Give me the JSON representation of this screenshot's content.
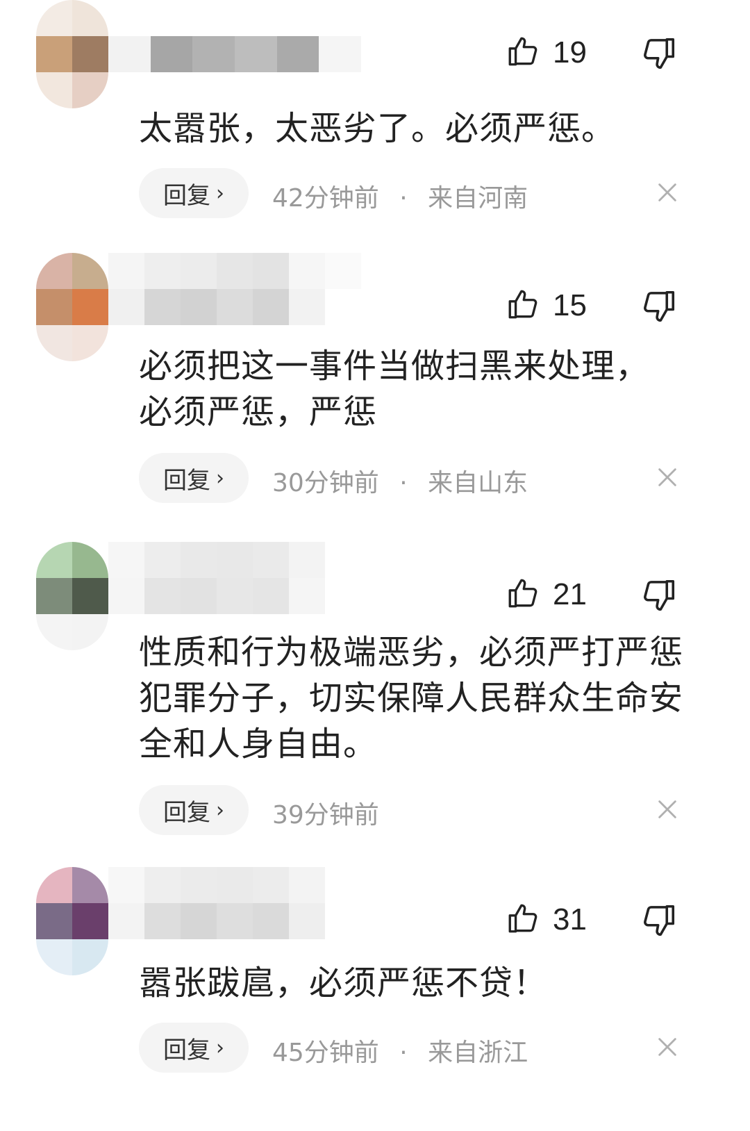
{
  "colors": {
    "text": "#222222",
    "meta": "#999999",
    "reply_bg": "#f4f4f4"
  },
  "comments": [
    {
      "likes": "19",
      "text": "太嚣张，太恶劣了。必须严惩。",
      "reply_label": "回复",
      "time": "42分钟前",
      "separator": "·",
      "location": "来自河南"
    },
    {
      "likes": "15",
      "text": "必须把这一事件当做扫黑来处理，必须严惩，严惩",
      "reply_label": "回复",
      "time": "30分钟前",
      "separator": "·",
      "location": "来自山东"
    },
    {
      "likes": "21",
      "text": "性质和行为极端恶劣，必须严打严惩犯罪分子，切实保障人民群众生命安全和人身自由。",
      "reply_label": "回复",
      "time": "39分钟前",
      "separator": "",
      "location": ""
    },
    {
      "likes": "31",
      "text": "嚣张跋扈，必须严惩不贷！",
      "reply_label": "回复",
      "time": "45分钟前",
      "separator": "·",
      "location": "来自浙江"
    }
  ]
}
